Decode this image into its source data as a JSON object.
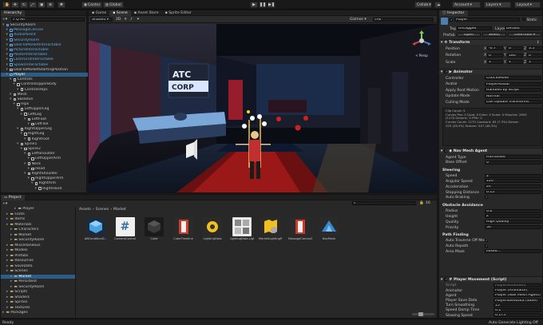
{
  "toolbar": {
    "account_initial": "A",
    "layers_hint": "",
    "center_label": "Center",
    "global_label": "Global",
    "collab_label": "Collab",
    "account_label": "Account",
    "layers_label": "Layers",
    "layout_label": "Layout"
  },
  "hierarchy": {
    "tab": "Hierarchy",
    "search_placeholder": "Q All",
    "rows": [
      {
        "label": "SecurityRoom",
        "indent": 0,
        "type": "scene"
      },
      {
        "label": "MessageCanvas",
        "indent": 1,
        "type": "prefab"
      },
      {
        "label": "AudioParent",
        "indent": 1,
        "type": "prefab"
      },
      {
        "label": "SecurityRoom",
        "indent": 1,
        "type": "prefab"
      },
      {
        "label": "DoorToMarketInteractable",
        "indent": 1,
        "type": "prefab"
      },
      {
        "label": "PictureInteractable",
        "indent": 1,
        "type": "prefab"
      },
      {
        "label": "PosterInteractable",
        "indent": 1,
        "type": "prefab"
      },
      {
        "label": "LaserGridInteractable",
        "indent": 1,
        "type": "prefab"
      },
      {
        "label": "SpawnInteractable",
        "indent": 1,
        "type": "prefab"
      },
      {
        "label": "DoorToMarketStartingPosition",
        "indent": 1,
        "type": "object"
      },
      {
        "label": "Player",
        "indent": 1,
        "type": "prefab",
        "selected": true
      },
      {
        "label": "Controls",
        "indent": 2,
        "type": "object"
      },
      {
        "label": "ControlsUpperBody",
        "indent": 3,
        "type": "object"
      },
      {
        "label": "ControlsHips",
        "indent": 4,
        "type": "object"
      },
      {
        "label": "Mesh",
        "indent": 2,
        "type": "object"
      },
      {
        "label": "Skeleton",
        "indent": 2,
        "type": "object"
      },
      {
        "label": "Hips",
        "indent": 3,
        "type": "object"
      },
      {
        "label": "LeftUpperLeg",
        "indent": 4,
        "type": "object"
      },
      {
        "label": "LeftLeg",
        "indent": 5,
        "type": "object"
      },
      {
        "label": "LeftFoot",
        "indent": 6,
        "type": "object"
      },
      {
        "label": "LeftToe",
        "indent": 7,
        "type": "object"
      },
      {
        "label": "RightUpperLeg",
        "indent": 4,
        "type": "object"
      },
      {
        "label": "RightLeg",
        "indent": 5,
        "type": "object"
      },
      {
        "label": "RightFoot",
        "indent": 6,
        "type": "object"
      },
      {
        "label": "Spine1",
        "indent": 4,
        "type": "object"
      },
      {
        "label": "Spine2",
        "indent": 5,
        "type": "object"
      },
      {
        "label": "LeftShoulder",
        "indent": 6,
        "type": "object"
      },
      {
        "label": "LeftUpperArm",
        "indent": 7,
        "type": "object"
      },
      {
        "label": "Neck",
        "indent": 6,
        "type": "object"
      },
      {
        "label": "Head",
        "indent": 7,
        "type": "object"
      },
      {
        "label": "RightShoulder",
        "indent": 6,
        "type": "object"
      },
      {
        "label": "RightUpperArm",
        "indent": 7,
        "type": "object"
      },
      {
        "label": "RightArm",
        "indent": 8,
        "type": "object"
      },
      {
        "label": "RightHand",
        "indent": 9,
        "type": "object"
      }
    ]
  },
  "scene": {
    "tabs": [
      "Game",
      "Scene",
      "Asset Store",
      "Sprite Editor"
    ],
    "active_tab": 1,
    "shading": "Shaded",
    "mode_2d": "2D",
    "gizmos": "Gizmos",
    "all_label": "All",
    "persp_label": "< Persp",
    "sign_line1": "ATC",
    "sign_line2": "CORP"
  },
  "project": {
    "tab": "Project",
    "breadcrumb": [
      "Assets",
      "Scenes",
      "Market"
    ],
    "tree": [
      {
        "label": "Player",
        "indent": 3
      },
      {
        "label": "Fonts",
        "indent": 1
      },
      {
        "label": "Items",
        "indent": 1
      },
      {
        "label": "Materials",
        "indent": 1
      },
      {
        "label": "Characters",
        "indent": 2
      },
      {
        "label": "Market",
        "indent": 2
      },
      {
        "label": "SecurityRoom",
        "indent": 2
      },
      {
        "label": "Miscellaneous",
        "indent": 1
      },
      {
        "label": "Models",
        "indent": 1
      },
      {
        "label": "Prefabs",
        "indent": 1
      },
      {
        "label": "Resources",
        "indent": 1
      },
      {
        "label": "SaveData",
        "indent": 1
      },
      {
        "label": "Scenes",
        "indent": 1
      },
      {
        "label": "Market",
        "indent": 2,
        "selected": true
      },
      {
        "label": "Persistent",
        "indent": 2
      },
      {
        "label": "SecurityRoom",
        "indent": 2
      },
      {
        "label": "Scripts",
        "indent": 1
      },
      {
        "label": "Shaders",
        "indent": 1
      },
      {
        "label": "Sprites",
        "indent": 1
      },
      {
        "label": "Textures",
        "indent": 1
      },
      {
        "label": "Packages",
        "indent": 0
      }
    ],
    "assets": [
      {
        "label": "ABConditionD...",
        "icon": "cube-blue"
      },
      {
        "label": "CameraControl",
        "icon": "script"
      },
      {
        "label": "Cube",
        "icon": "cube-dark"
      },
      {
        "label": "CubeTimeline",
        "icon": "timeline"
      },
      {
        "label": "LightingData",
        "icon": "lightbulb"
      },
      {
        "label": "LightingData.Lighting",
        "icon": "photo"
      },
      {
        "label": "MarketLightingP...",
        "icon": "map-gear"
      },
      {
        "label": "MessageCanvasT...",
        "icon": "timeline"
      },
      {
        "label": "NavMesh",
        "icon": "navmesh"
      }
    ],
    "count_badge": "16"
  },
  "inspector": {
    "tab": "Inspector",
    "name": "Player",
    "static_label": "Static",
    "tag_label": "Tag",
    "tag_value": "Untagged",
    "layer_label": "Layer",
    "layer_value": "Default",
    "prefab_label": "Prefab",
    "open_label": "Open",
    "select_label": "Select",
    "overrides_label": "Overrides",
    "transform": {
      "title": "Transform",
      "position": {
        "label": "Position",
        "x": "-0.7",
        "y": "0",
        "z": "3.5"
      },
      "rotation": {
        "label": "Rotation",
        "x": "0",
        "y": "180",
        "z": "0"
      },
      "scale": {
        "label": "Scale",
        "x": "1",
        "y": "1",
        "z": "1"
      }
    },
    "animator": {
      "title": "Animator",
      "rows": [
        {
          "label": "Controller",
          "value": "ClickToMove"
        },
        {
          "label": "Avatar",
          "value": "PlayerAvatar"
        },
        {
          "label": "Apply Root Motion",
          "value": "Handled by Script"
        },
        {
          "label": "Update Mode",
          "value": "Normal"
        },
        {
          "label": "Culling Mode",
          "value": "Cull Update Transforms"
        }
      ],
      "info": [
        "Clip Count: 5",
        "Curves Pos: 0 Quat: 0 Euler: 0 Scale: 0 Muscles: 2655",
        "(1170 Generic: 0 PPtr: 0",
        "Curves Count: 1170 Constant: 83 (7.3%) Dense:",
        "325 (28.3%) Stream: 547 (48.3%)"
      ]
    },
    "navmesh": {
      "title": "Nav Mesh Agent",
      "agent_type_label": "Agent Type",
      "agent_type_value": "Humanoid",
      "base_offset_label": "Base Offset",
      "base_offset_value": "0",
      "steering_title": "Steering",
      "speed": {
        "label": "Speed",
        "value": "2"
      },
      "angular": {
        "label": "Angular Speed",
        "value": "120"
      },
      "accel": {
        "label": "Acceleration",
        "value": "20"
      },
      "stopping": {
        "label": "Stopping Distance",
        "value": "0.15"
      },
      "autobrake": {
        "label": "Auto Braking",
        "value": "✓"
      },
      "obstacle_title": "Obstacle Avoidance",
      "radius": {
        "label": "Radius",
        "value": "0.6"
      },
      "height": {
        "label": "Height",
        "value": "2"
      },
      "quality": {
        "label": "Quality",
        "value": "High Quality"
      },
      "priority": {
        "label": "Priority",
        "value": "50"
      },
      "path_title": "Path Finding",
      "auto_traverse": {
        "label": "Auto Traverse Off Mesh",
        "value": "✓"
      },
      "auto_repath": {
        "label": "Auto Repath",
        "value": "✓"
      },
      "area_mask": {
        "label": "Area Mask",
        "value": "Mixed..."
      }
    },
    "movement": {
      "title": "Player Movement (Script)",
      "rows": [
        {
          "label": "Script",
          "value": "PlayerMovement"
        },
        {
          "label": "Animator",
          "value": "Player (Animator)"
        },
        {
          "label": "Agent",
          "value": "Player (Nav Mesh Agent)"
        },
        {
          "label": "Player Save Data",
          "value": "PlayerSaveData (Save)"
        },
        {
          "label": "Turn Smoothing",
          "value": "15"
        },
        {
          "label": "Speed Damp Time",
          "value": "0.1"
        },
        {
          "label": "Slowing Speed",
          "value": "0.175"
        }
      ]
    }
  },
  "status": {
    "left": "Ready",
    "right": "Auto Generate Lighting Off"
  },
  "colors": {
    "selection": "#2c5d87",
    "accent_blue": "#5fa8e8",
    "panel": "#282828"
  }
}
